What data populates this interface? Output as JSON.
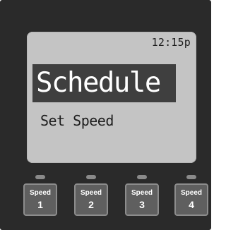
{
  "display": {
    "time": "12:15p",
    "mode_title": "Schedule",
    "subtitle": "Set Speed"
  },
  "buttons": [
    {
      "label": "Speed",
      "number": "1"
    },
    {
      "label": "Speed",
      "number": "2"
    },
    {
      "label": "Speed",
      "number": "3"
    },
    {
      "label": "Speed",
      "number": "4"
    }
  ],
  "colors": {
    "panel": "#2a2a2a",
    "lcd": "#c4c4c4",
    "highlight": "#3f3f3f",
    "button": "#5f5f5f",
    "led": "#8a8a8a"
  }
}
